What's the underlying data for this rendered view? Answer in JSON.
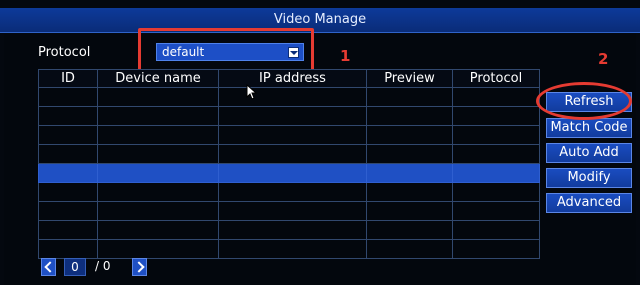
{
  "window": {
    "title": "Video Manage"
  },
  "protocol": {
    "label": "Protocol",
    "selected": "default"
  },
  "table": {
    "columns": [
      "ID",
      "Device name",
      "IP address",
      "Preview",
      "Protocol"
    ],
    "row_count": 9,
    "selected_row_index": 4
  },
  "buttons": {
    "refresh": "Refresh",
    "match_code": "Match Code",
    "auto_add": "Auto Add",
    "modify": "Modify",
    "advanced": "Advanced"
  },
  "pagination": {
    "current": "0",
    "separator": "/",
    "total": "0"
  },
  "annotations": {
    "marker_1": "1",
    "marker_2": "2",
    "color": "#e53b32"
  },
  "icons": {
    "select_arrow": "chevron-down-icon",
    "prev": "chevron-left-icon",
    "next": "chevron-right-icon",
    "cursor": "mouse-pointer-icon"
  }
}
